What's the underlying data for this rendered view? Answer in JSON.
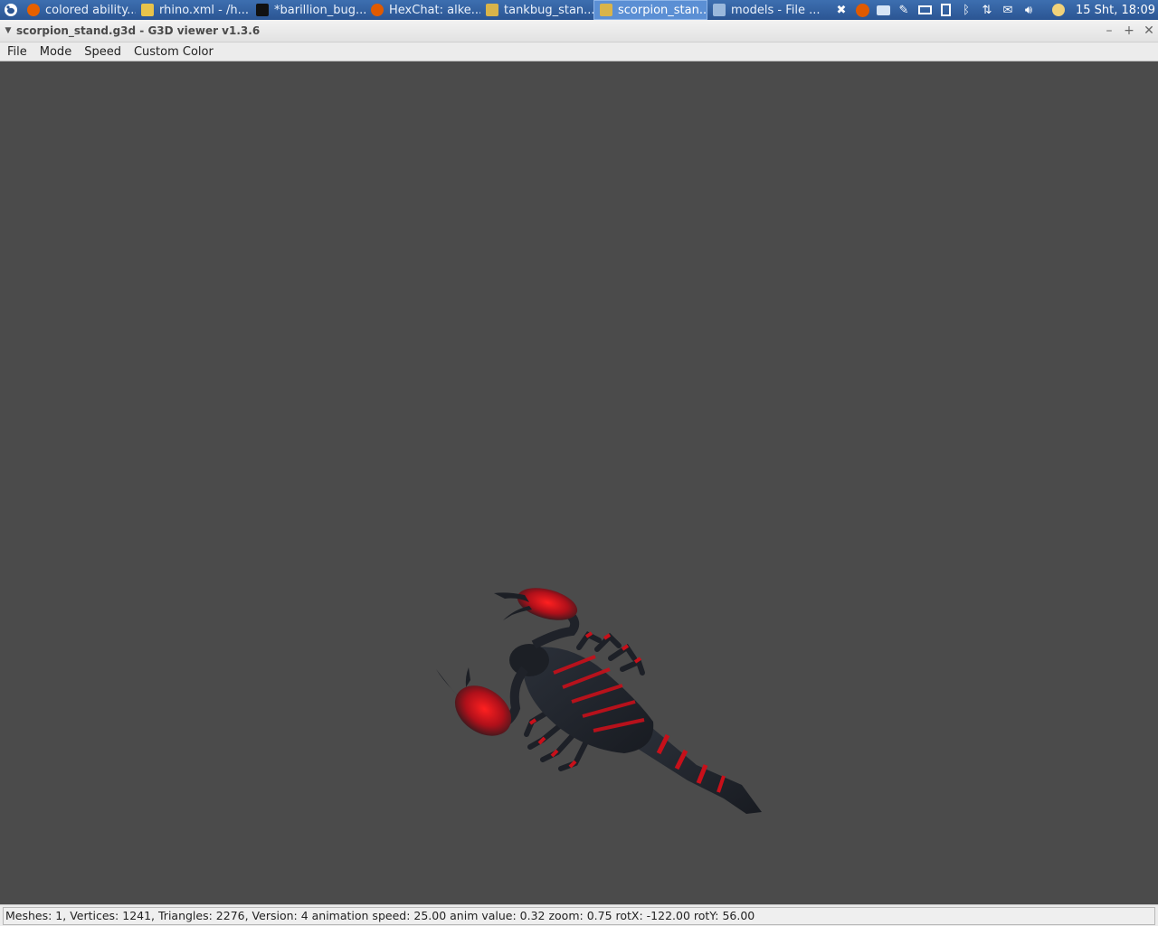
{
  "taskbar": {
    "tasks": [
      {
        "label": "colored ability...",
        "icon": "firefox-icon",
        "color": "#e66000"
      },
      {
        "label": "rhino.xml - /h...",
        "icon": "text-editor-icon",
        "color": "#e8c34a"
      },
      {
        "label": "*barillion_bug...",
        "icon": "terminal-icon",
        "color": "#111111"
      },
      {
        "label": "HexChat: alke...",
        "icon": "hexchat-icon",
        "color": "#e05a00"
      },
      {
        "label": "tankbug_stan...",
        "icon": "image-viewer-icon",
        "color": "#d9b44a"
      },
      {
        "label": "scorpion_stan...",
        "icon": "image-viewer-icon",
        "color": "#d9b44a"
      },
      {
        "label": "models - File ...",
        "icon": "folder-icon",
        "color": "#9ab8dc"
      }
    ],
    "active_index": 5,
    "clock": "15 Sht, 18:09"
  },
  "window": {
    "title": "scorpion_stand.g3d - G3D viewer v1.3.6"
  },
  "menubar": {
    "items": [
      "File",
      "Mode",
      "Speed",
      "Custom Color"
    ]
  },
  "status": {
    "text": "Meshes: 1, Vertices: 1241, Triangles: 2276, Version: 4 animation speed: 25.00 anim value: 0.32 zoom: 0.75 rotX: -122.00 rotY: 56.00"
  },
  "colors": {
    "viewport_bg": "#4b4b4b",
    "scorpion_body": "#1f2229",
    "scorpion_accent": "#c8101a"
  }
}
